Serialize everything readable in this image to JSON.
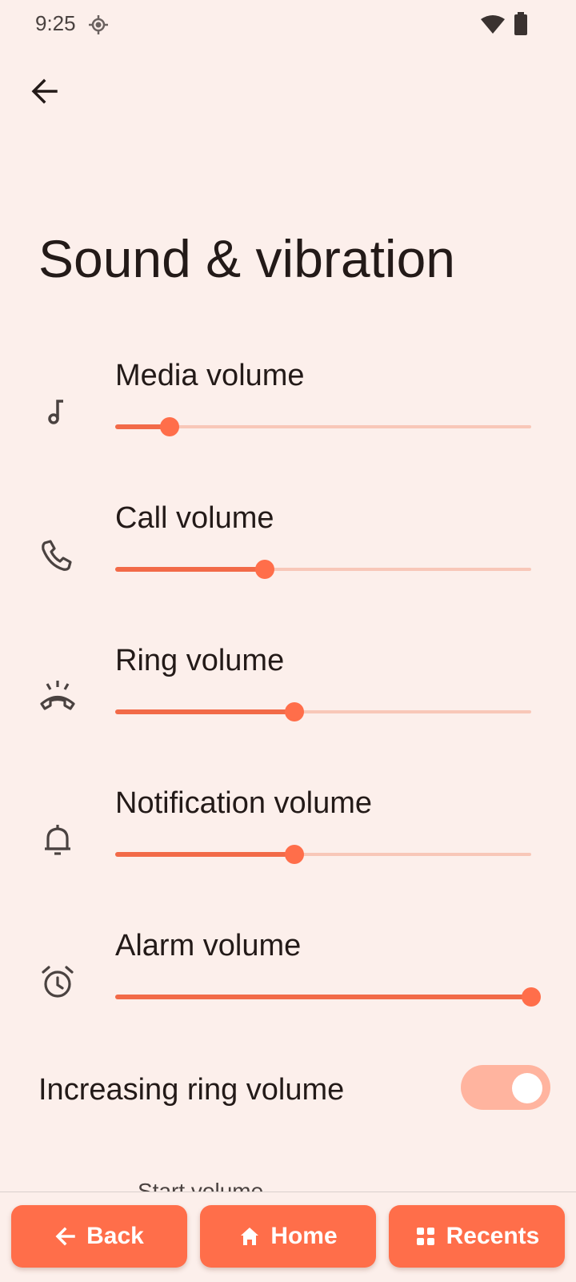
{
  "status_bar": {
    "time": "9:25",
    "icons": [
      "location-icon",
      "wifi-icon",
      "battery-icon"
    ]
  },
  "header": {
    "back_icon": "arrow-left-icon",
    "title": "Sound & vibration"
  },
  "volume_sliders": [
    {
      "label": "Media volume",
      "icon": "music-note-icon",
      "level_percent": 13
    },
    {
      "label": "Call volume",
      "icon": "phone-icon",
      "level_percent": 36
    },
    {
      "label": "Ring volume",
      "icon": "ringing-phone-icon",
      "level_percent": 43
    },
    {
      "label": "Notification volume",
      "icon": "bell-icon",
      "level_percent": 43
    },
    {
      "label": "Alarm volume",
      "icon": "alarm-clock-icon",
      "level_percent": 100
    }
  ],
  "increasing_ring": {
    "label": "Increasing ring volume",
    "enabled": true
  },
  "partial_setting": {
    "label": "Start volume"
  },
  "nav": {
    "back": {
      "label": "Back",
      "icon": "arrow-left-icon"
    },
    "home": {
      "label": "Home",
      "icon": "home-icon"
    },
    "recents": {
      "label": "Recents",
      "icon": "recents-grid-icon"
    }
  },
  "colors": {
    "background": "#fcefeb",
    "accent": "#ff6e4a",
    "slider_fill": "#f26a48",
    "slider_track": "#f8c7b8",
    "toggle_track": "#ffb49f",
    "text": "#231a18"
  }
}
